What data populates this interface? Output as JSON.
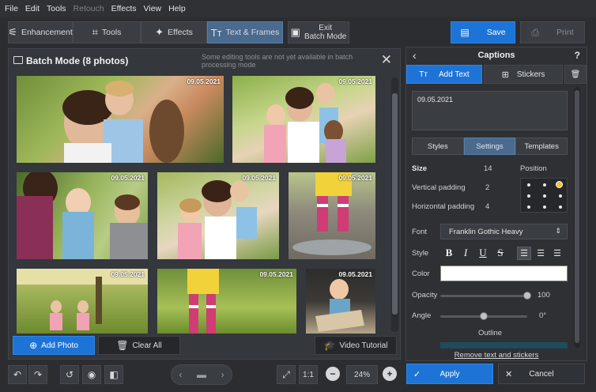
{
  "menu": [
    "File",
    "Edit",
    "Tools",
    "Retouch",
    "Effects",
    "View",
    "Help"
  ],
  "toolbar": {
    "enhancement": "Enhancement",
    "tools": "Tools",
    "effects": "Effects",
    "text_frames": "Text & Frames",
    "exit_line1": "Exit",
    "exit_line2": "Batch Mode",
    "save": "Save",
    "print": "Print"
  },
  "batch": {
    "title": "Batch Mode (8 photos)",
    "note": "Some editing tools are not yet available in batch processing mode",
    "photo_date": "09.05.2021",
    "add_photo": "Add Photo",
    "clear_all": "Clear All",
    "video_tutorial": "Video Tutorial"
  },
  "bottom": {
    "zoom": "24%",
    "ratio": "1:1"
  },
  "captions": {
    "title": "Captions",
    "help": "?",
    "add_text": "Add Text",
    "stickers": "Stickers",
    "text_value": "09.05.2021",
    "tabs": [
      "Styles",
      "Settings",
      "Templates"
    ],
    "size_label": "Size",
    "size_value": "14",
    "position_label": "Position",
    "vpad_label": "Vertical padding",
    "vpad_value": "2",
    "hpad_label": "Horizontal padding",
    "hpad_value": "4",
    "font_label": "Font",
    "font_value": "Franklin Gothic Heavy",
    "style_label": "Style",
    "style_bold": "B",
    "style_italic": "I",
    "style_underline": "U",
    "style_strike": "S",
    "color_label": "Color",
    "color_value": "#ffffff",
    "opacity_label": "Opacity",
    "opacity_value": "100",
    "opacity_level": 1.0,
    "angle_label": "Angle",
    "angle_value": "0°",
    "angle_level": 0.5,
    "outline_label": "Outline",
    "remove_link": "Remove text and stickers",
    "apply": "Apply",
    "cancel": "Cancel"
  },
  "colors": {
    "accent": "#1e74d6",
    "active_tab": "#4a6a8e",
    "background": "#2b2d31",
    "position_selected": "#f2c233"
  }
}
